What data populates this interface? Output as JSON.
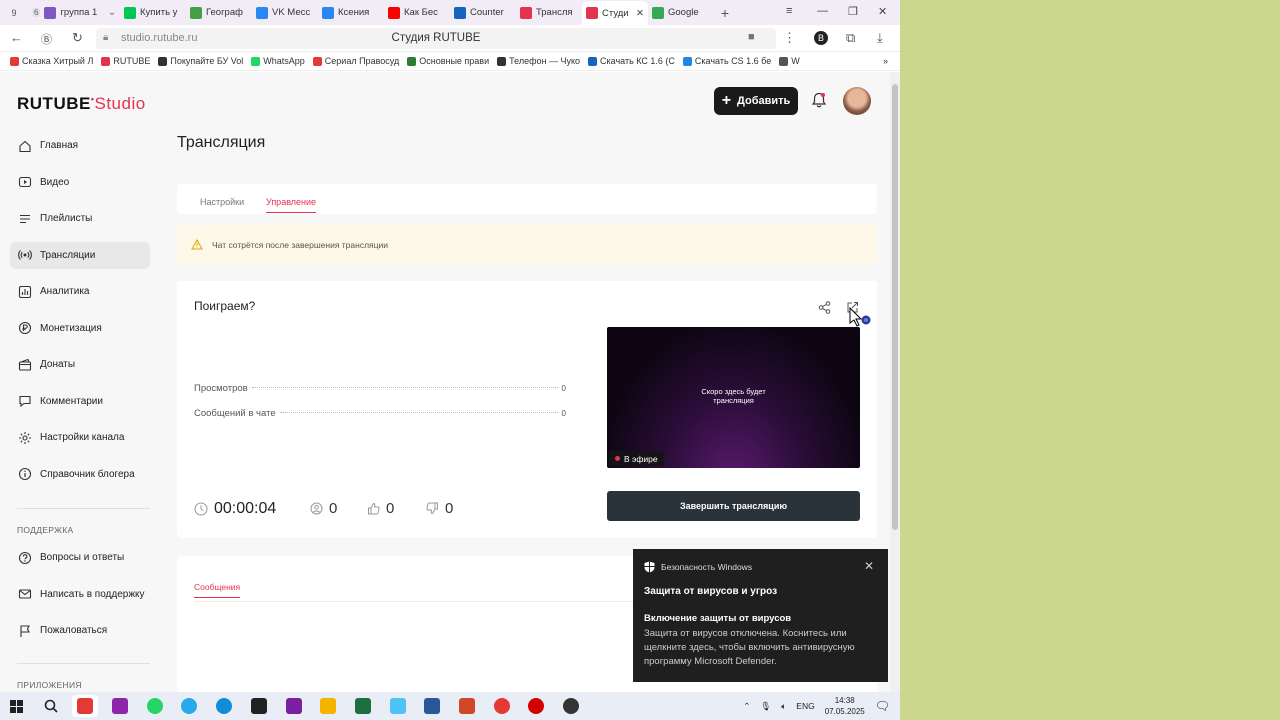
{
  "browser": {
    "tabs": [
      {
        "label": "группа 1",
        "count": "6",
        "color": "#7e57c2"
      },
      {
        "label": "Купить у",
        "color": "#00c853"
      },
      {
        "label": "Географ",
        "color": "#43a047"
      },
      {
        "label": "VK Месс",
        "color": "#2787f5"
      },
      {
        "label": "Ксения",
        "color": "#2787f5"
      },
      {
        "label": "Как Бес",
        "color": "#ff0000"
      },
      {
        "label": "Counter",
        "color": "#1565c0"
      },
      {
        "label": "Трансля",
        "color": "#e3334f"
      },
      {
        "label": "Студи",
        "color": "#e3334f"
      },
      {
        "label": "Google",
        "color": "#34a853"
      }
    ],
    "url": "studio.rutube.ru",
    "page_title": "Студия RUTUBE",
    "bookmarks": [
      {
        "label": "Сказка Хитрый Л",
        "color": "#e53935"
      },
      {
        "label": "RUTUBE",
        "color": "#e3334f"
      },
      {
        "label": "Покупайте БУ Vol",
        "color": "#333333"
      },
      {
        "label": "WhatsApp",
        "color": "#25d366"
      },
      {
        "label": "Сериал Правосуд",
        "color": "#e53935"
      },
      {
        "label": "Основные прави",
        "color": "#2e7d32"
      },
      {
        "label": "Телефон — Чуко",
        "color": "#333333"
      },
      {
        "label": "Скачать КС 1.6 (С",
        "color": "#1565c0"
      },
      {
        "label": "Скачать CS 1.6 бе",
        "color": "#1e88e5"
      },
      {
        "label": "W",
        "color": "#555555"
      }
    ]
  },
  "app": {
    "logo_main": "RUTUBE",
    "logo_sub": "Studio",
    "add_button": "Добавить",
    "accent": "#e3334f"
  },
  "sidebar": {
    "items": [
      {
        "label": "Главная",
        "icon": "home-icon"
      },
      {
        "label": "Видео",
        "icon": "video-icon"
      },
      {
        "label": "Плейлисты",
        "icon": "playlist-icon"
      },
      {
        "label": "Трансляции",
        "icon": "broadcast-icon",
        "active": true
      },
      {
        "label": "Аналитика",
        "icon": "analytics-icon"
      },
      {
        "label": "Монетизация",
        "icon": "monetization-icon"
      },
      {
        "label": "Донаты",
        "icon": "donate-icon"
      },
      {
        "label": "Комментарии",
        "icon": "comments-icon"
      },
      {
        "label": "Настройки канала",
        "icon": "settings-icon"
      },
      {
        "label": "Справочник блогера",
        "icon": "info-icon"
      }
    ],
    "support_header": "ПОДДЕРЖКА",
    "support_items": [
      {
        "label": "Вопросы и ответы",
        "icon": "question-icon"
      },
      {
        "label": "Написать в поддержку",
        "icon": "mail-icon"
      },
      {
        "label": "Пожаловаться",
        "icon": "flag-icon"
      }
    ],
    "apps_header": "ПРИЛОЖЕНИЯ"
  },
  "main": {
    "title": "Трансляция",
    "tabs": [
      "Настройки",
      "Управление"
    ],
    "warning": "Чат сотрётся после завершения трансляции",
    "stream": {
      "title": "Поиграем?",
      "stats": [
        {
          "label": "Просмотров",
          "value": "0"
        },
        {
          "label": "Сообщений в чате",
          "value": "0"
        }
      ],
      "timer": "00:00:04",
      "viewers": "0",
      "likes": "0",
      "dislikes": "0",
      "preview_text": "Скоро здесь будет трансляция",
      "live_badge": "В эфире",
      "end_button": "Завершить трансляцию"
    },
    "messages_tab": "Сообщения"
  },
  "toast": {
    "app": "Безопасность Windows",
    "title": "Защита от вирусов и угроз",
    "subtitle": "Включение защиты от вирусов",
    "body": "Защита от вирусов отключена. Коснитесь или щелкните здесь, чтобы включить антивирусную программу Microsoft Defender."
  },
  "taskbar": {
    "lang": "ENG",
    "time": "14:38",
    "date": "07.05.2025",
    "apps": [
      {
        "icon": "yandex-browser-icon",
        "color": "#e53935"
      },
      {
        "icon": "ip-app-icon",
        "color": "#8e24aa"
      },
      {
        "icon": "whatsapp-icon",
        "color": "#25d366"
      },
      {
        "icon": "telegram-icon",
        "color": "#29a9eb"
      },
      {
        "icon": "edge-icon",
        "color": "#0f8dd8"
      },
      {
        "icon": "media-app-icon",
        "color": "#222222"
      },
      {
        "icon": "teams-icon",
        "color": "#7b1fa2"
      },
      {
        "icon": "explorer-icon",
        "color": "#f4b400"
      },
      {
        "icon": "excel-icon",
        "color": "#1d6f42"
      },
      {
        "icon": "photos-icon",
        "color": "#4fc3f7"
      },
      {
        "icon": "word-icon",
        "color": "#2b579a"
      },
      {
        "icon": "powerpoint-icon",
        "color": "#d24726"
      },
      {
        "icon": "yandex-icon",
        "color": "#e53935"
      },
      {
        "icon": "opera-icon",
        "color": "#d50000"
      },
      {
        "icon": "obs-icon",
        "color": "#333333"
      }
    ]
  }
}
